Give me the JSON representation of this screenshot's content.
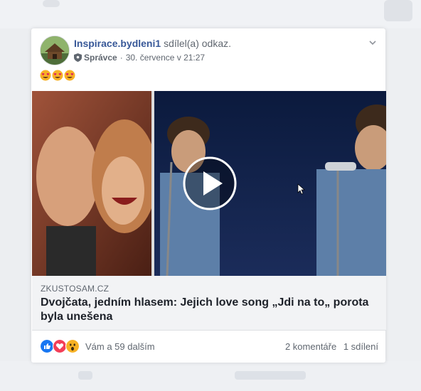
{
  "post": {
    "page_name": "Inspirace.bydleni1",
    "shared_text": "sdílel(a) odkaz.",
    "role": "Správce",
    "separator": "·",
    "timestamp": "30. července v 21:27",
    "emojis": [
      "heart-eyes",
      "heart-eyes",
      "heart-eyes"
    ]
  },
  "link": {
    "domain": "ZKUSTOSAM.CZ",
    "title": "Dvojčata, jedním hlasem: Jejich love song „Jdi na to„ porota byla unešena"
  },
  "footer": {
    "reactions": [
      "like",
      "love",
      "wow"
    ],
    "reaction_text": "Vám a 59 dalším",
    "comments": "2 komentáře",
    "shares": "1 sdílení"
  },
  "colors": {
    "link_blue": "#385898",
    "like_blue": "#1877f2",
    "love_red": "#f33e58",
    "wow_yellow": "#f7b125"
  }
}
